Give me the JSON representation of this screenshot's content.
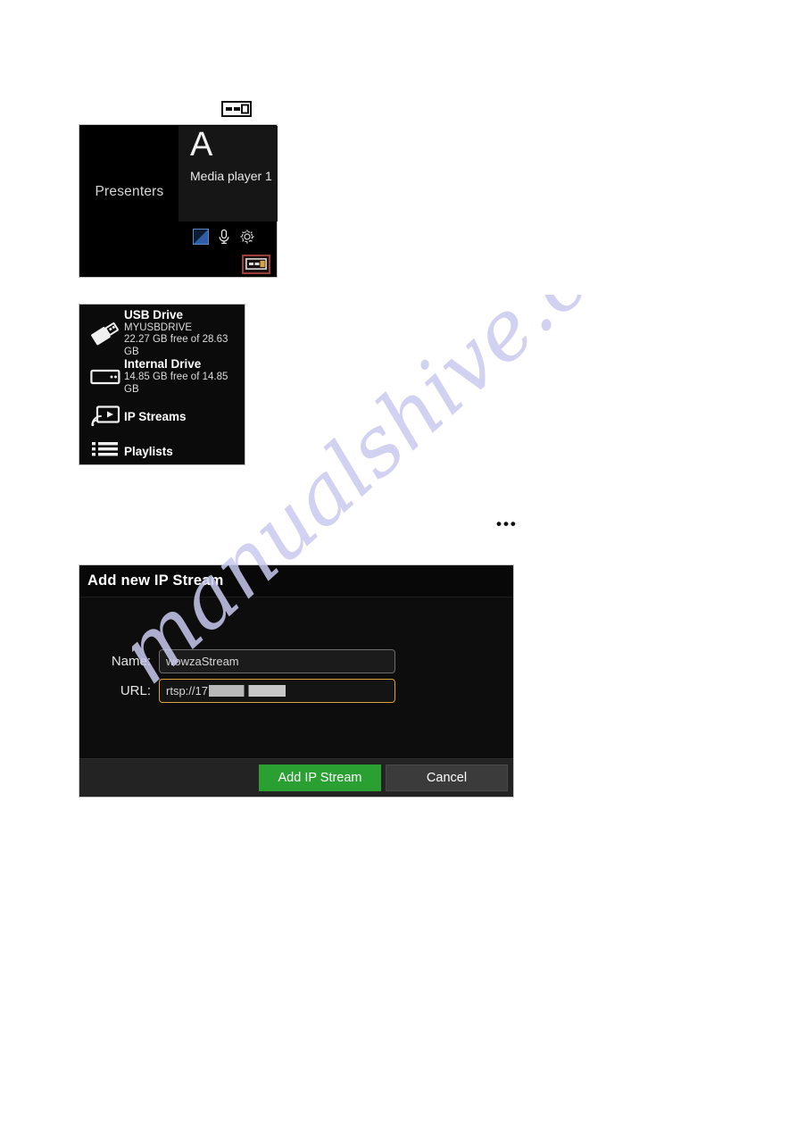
{
  "watermark": {
    "text": "manualshive.com"
  },
  "top_icon": {
    "name": "source-select-icon",
    "glyph": "source-select"
  },
  "presenter_panel": {
    "presenters_label": "Presenters",
    "media_player": {
      "letter": "A",
      "name": "Media player 1"
    },
    "toolbar_icons": [
      {
        "name": "video-source-icon",
        "glyph": "split-square"
      },
      {
        "name": "microphone-icon",
        "glyph": "microphone"
      },
      {
        "name": "settings-gear-icon",
        "glyph": "gear"
      }
    ],
    "source_button": {
      "name": "source-select-icon",
      "highlight_color": "#9e3b3b"
    }
  },
  "drives_panel": {
    "items": [
      {
        "icon": "usb-drive-icon",
        "title": "USB Drive",
        "sub1": "MYUSBDRIVE",
        "sub2": "22.27 GB free of 28.63 GB"
      },
      {
        "icon": "internal-drive-icon",
        "title": "Internal Drive",
        "sub1": "14.85 GB free of 14.85 GB",
        "sub2": ""
      },
      {
        "icon": "ip-stream-icon",
        "title": "IP Streams",
        "sub1": "",
        "sub2": ""
      },
      {
        "icon": "playlists-icon",
        "title": "Playlists",
        "sub1": "",
        "sub2": ""
      }
    ]
  },
  "ellipsis": {
    "text": "•••"
  },
  "dialog": {
    "title": "Add new IP Stream",
    "fields": [
      {
        "label": "Name:",
        "value": "wowzaStream",
        "placeholder": "Name",
        "focused": false
      },
      {
        "label": "URL:",
        "value": "rtsp://17",
        "placeholder": "URL",
        "focused": true,
        "redacted": true
      }
    ],
    "buttons": {
      "primary": "Add IP Stream",
      "secondary": "Cancel"
    },
    "colors": {
      "primary_button": "#2aa032",
      "secondary_button": "#3b3b3b",
      "focus_border": "#d9a43a"
    }
  }
}
